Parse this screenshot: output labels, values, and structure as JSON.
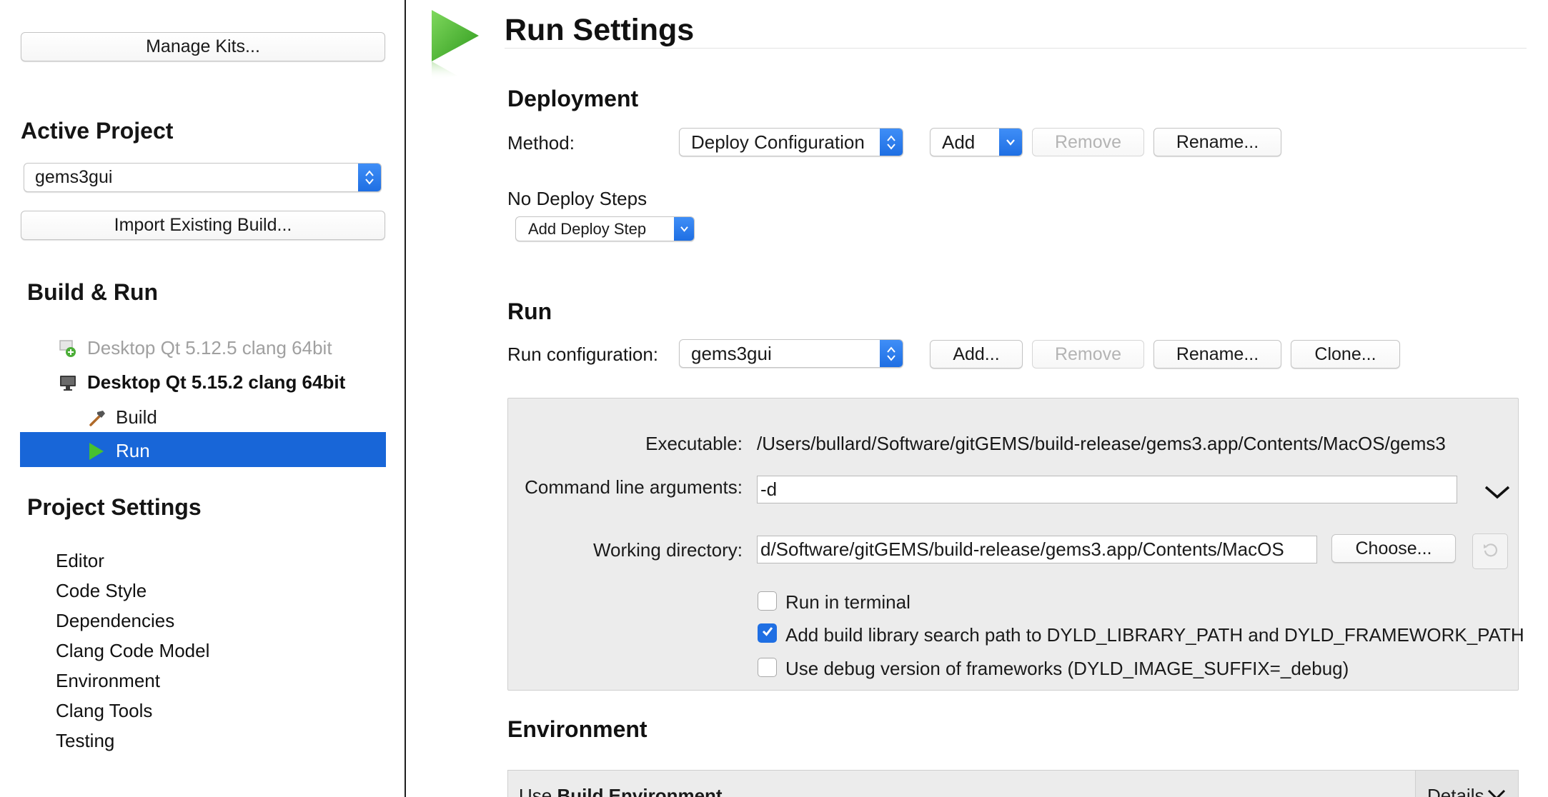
{
  "sidebar": {
    "manage_kits_label": "Manage Kits...",
    "active_project_heading": "Active Project",
    "project_selected": "gems3gui",
    "import_build_label": "Import Existing Build...",
    "build_run_heading": "Build & Run",
    "kits": [
      {
        "label": "Desktop Qt 5.12.5 clang 64bit",
        "state": "inactive"
      },
      {
        "label": "Desktop Qt 5.15.2 clang 64bit",
        "state": "active"
      }
    ],
    "kit_children": [
      {
        "label": "Build",
        "icon": "hammer-icon"
      },
      {
        "label": "Run",
        "icon": "play-icon",
        "selected": true
      }
    ],
    "project_settings_heading": "Project Settings",
    "project_settings_items": [
      "Editor",
      "Code Style",
      "Dependencies",
      "Clang Code Model",
      "Environment",
      "Clang Tools",
      "Testing"
    ]
  },
  "main": {
    "title": "Run Settings",
    "deployment": {
      "heading": "Deployment",
      "method_label": "Method:",
      "method_value": "Deploy Configuration",
      "add_label": "Add",
      "remove_label": "Remove",
      "rename_label": "Rename...",
      "no_steps_label": "No Deploy Steps",
      "add_step_label": "Add Deploy Step"
    },
    "run": {
      "heading": "Run",
      "config_label": "Run configuration:",
      "config_value": "gems3gui",
      "add_label": "Add...",
      "remove_label": "Remove",
      "rename_label": "Rename...",
      "clone_label": "Clone...",
      "executable_label": "Executable:",
      "executable_value": "/Users/bullard/Software/gitGEMS/build-release/gems3.app/Contents/MacOS/gems3",
      "args_label": "Command line arguments:",
      "args_value": "-d",
      "workdir_label": "Working directory:",
      "workdir_value": "d/Software/gitGEMS/build-release/gems3.app/Contents/MacOS",
      "choose_label": "Choose...",
      "checkboxes": [
        {
          "label": "Run in terminal",
          "checked": false
        },
        {
          "label": "Add build library search path to DYLD_LIBRARY_PATH and DYLD_FRAMEWORK_PATH",
          "checked": true
        },
        {
          "label": "Use debug version of frameworks (DYLD_IMAGE_SUFFIX=_debug)",
          "checked": false
        }
      ]
    },
    "environment": {
      "heading": "Environment",
      "use_prefix": "Use ",
      "use_env": "Build Environment",
      "details_label": "Details"
    }
  },
  "colors": {
    "accent": "#1f6fe3",
    "selection": "#1866d8",
    "run_green": "#3cae2a"
  }
}
